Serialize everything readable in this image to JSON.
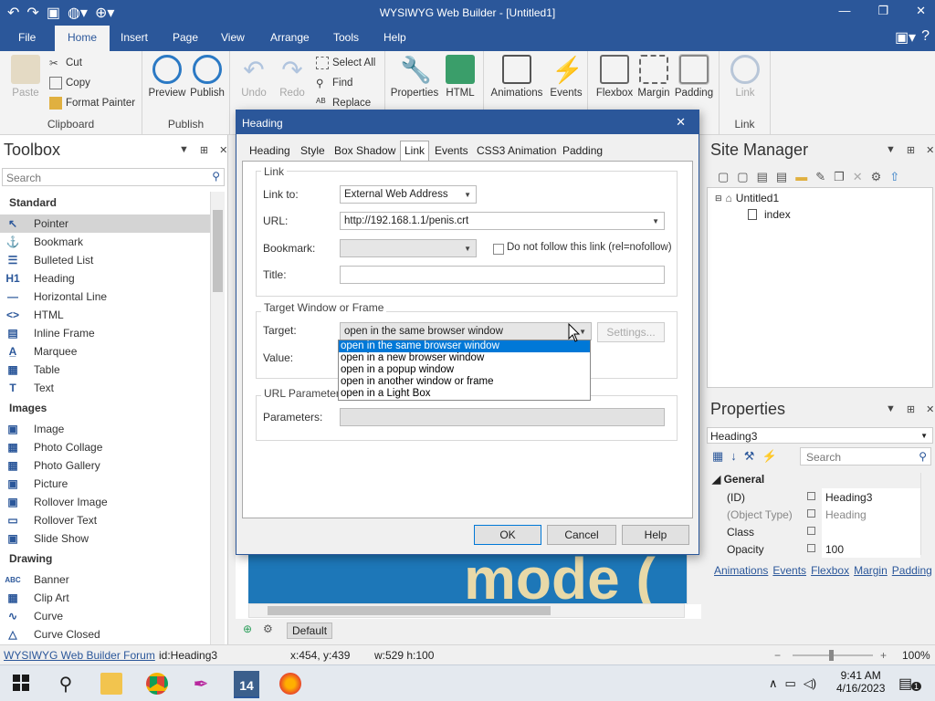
{
  "window": {
    "title": "WYSIWYG Web Builder - [Untitled1]",
    "quick_access": [
      "undo-icon",
      "redo-icon",
      "save-icon",
      "preview-icon",
      "publish-icon"
    ]
  },
  "menu": {
    "tabs": [
      "File",
      "Home",
      "Insert",
      "Page",
      "View",
      "Arrange",
      "Tools",
      "Help"
    ],
    "active": "Home"
  },
  "ribbon": {
    "clipboard": {
      "paste": "Paste",
      "cut": "Cut",
      "copy": "Copy",
      "format_painter": "Format Painter",
      "group": "Clipboard"
    },
    "publish": {
      "preview": "Preview",
      "publish": "Publish",
      "group": "Publish"
    },
    "edit": {
      "undo": "Undo",
      "redo": "Redo",
      "select_all": "Select All",
      "find": "Find",
      "replace": "Replace"
    },
    "props": {
      "properties": "Properties",
      "html": "HTML"
    },
    "anim": {
      "animations": "Animations",
      "events": "Events"
    },
    "layout": {
      "flexbox": "Flexbox",
      "margin": "Margin",
      "padding": "Padding"
    },
    "link": {
      "link": "Link",
      "group": "Link"
    }
  },
  "toolbox": {
    "title": "Toolbox",
    "search_placeholder": "Search",
    "categories": [
      {
        "name": "Standard",
        "items": [
          "Pointer",
          "Bookmark",
          "Bulleted List",
          "Heading",
          "Horizontal Line",
          "HTML",
          "Inline Frame",
          "Marquee",
          "Table",
          "Text"
        ]
      },
      {
        "name": "Images",
        "items": [
          "Image",
          "Photo Collage",
          "Photo Gallery",
          "Picture",
          "Rollover Image",
          "Rollover Text",
          "Slide Show"
        ]
      },
      {
        "name": "Drawing",
        "items": [
          "Banner",
          "Clip Art",
          "Curve",
          "Curve Closed"
        ]
      }
    ],
    "selected": "Pointer"
  },
  "dialog": {
    "title": "Heading",
    "tabs": [
      "Heading",
      "Style",
      "Box Shadow",
      "Link",
      "Events",
      "CSS3 Animation",
      "Padding"
    ],
    "active_tab": "Link",
    "link_group": "Link",
    "link_to_label": "Link to:",
    "link_to_value": "External Web Address",
    "url_label": "URL:",
    "url_value": "http://192.168.1.1/penis.crt",
    "bookmark_label": "Bookmark:",
    "nofollow_label": "Do not follow this link (rel=nofollow)",
    "title_label": "Title:",
    "target_group": "Target Window or Frame",
    "target_label": "Target:",
    "target_value": "open in the same browser window",
    "settings_label": "Settings...",
    "value_label": "Value:",
    "url_params_group": "URL Parameters f",
    "parameters_label": "Parameters:",
    "target_options": [
      "open in the same browser window",
      "open in a new browser window",
      "open in a popup window",
      "open in another window or frame",
      "open in a Light Box"
    ],
    "ok": "OK",
    "cancel": "Cancel",
    "help": "Help"
  },
  "canvas": {
    "banner_text": "mode (",
    "bottom_default": "Default"
  },
  "site_manager": {
    "title": "Site Manager",
    "root": "Untitled1",
    "page": "index"
  },
  "properties": {
    "title": "Properties",
    "object": "Heading3",
    "search_placeholder": "Search",
    "section": "General",
    "rows": [
      {
        "name": "(ID)",
        "value": "Heading3"
      },
      {
        "name": "(Object Type)",
        "value": "Heading"
      },
      {
        "name": "Class",
        "value": ""
      },
      {
        "name": "Opacity",
        "value": "100"
      }
    ],
    "links": [
      "Animations",
      "Events",
      "Flexbox",
      "Margin",
      "Padding"
    ]
  },
  "statusbar": {
    "forum": "WYSIWYG Web Builder Forum",
    "id": "id:Heading3",
    "coords": "x:454, y:439",
    "size": "w:529 h:100",
    "zoom": "100%"
  },
  "taskbar": {
    "time": "9:41 AM",
    "date": "4/16/2023",
    "notif_count": "1"
  },
  "colors": {
    "accent": "#2b579a",
    "selection": "#0078d7",
    "banner": "#1d77b8"
  }
}
